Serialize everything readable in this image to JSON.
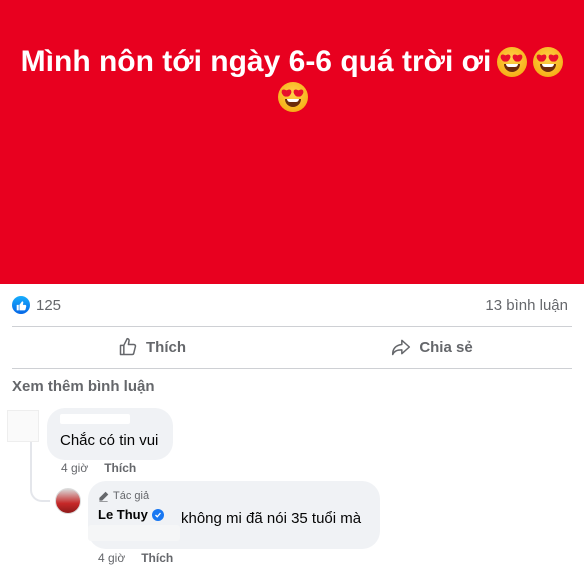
{
  "banner": {
    "line1": "Mình nôn tới ngày 6-6 quá trời ơi",
    "emojis": [
      "heart-eyes",
      "heart-eyes",
      "heart-eyes"
    ],
    "background_color": "#e8001f"
  },
  "stats": {
    "like_count": "125",
    "comment_count": "13 bình luận"
  },
  "actions": {
    "like_label": "Thích",
    "share_label": "Chia sẻ"
  },
  "comments": {
    "see_more": "Xem thêm bình luận",
    "first": {
      "text": "Chắc có tin vui",
      "time": "4 giờ",
      "like_label": "Thích"
    },
    "reply": {
      "author_tag": "Tác giả",
      "author_name": "Le Thuy",
      "text": "không mi đã nói 35 tuổi mà",
      "time": "4 giờ",
      "like_label": "Thích"
    }
  },
  "colors": {
    "accent": "#1877f2",
    "muted_text": "#65676b",
    "bubble": "#f0f2f5"
  }
}
